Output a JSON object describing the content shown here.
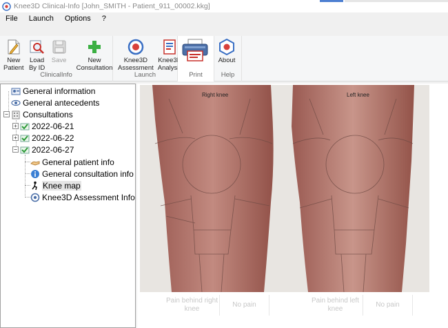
{
  "window": {
    "title": "Knee3D Clinical-Info  [John_SMITH - Patient_911_00002.kkg]"
  },
  "menu": {
    "items": [
      "File",
      "Launch",
      "Options",
      "?"
    ]
  },
  "ribbon": {
    "groups": [
      {
        "label": "ClinicalInfo",
        "buttons": [
          {
            "label": "New\nPatient"
          },
          {
            "label": "Load\nBy ID"
          },
          {
            "label": "Save"
          },
          {
            "label": "New\nConsultation"
          }
        ]
      },
      {
        "label": "Launch",
        "buttons": [
          {
            "label": "Knee3D\nAssessment"
          },
          {
            "label": "Knee3D\nAnalysis"
          }
        ]
      },
      {
        "label": "Print",
        "buttons": []
      },
      {
        "label": "Help",
        "buttons": [
          {
            "label": "About"
          }
        ]
      }
    ]
  },
  "tree": {
    "general_information": "General information",
    "general_antecedents": "General antecedents",
    "consultations": "Consultations",
    "dates": [
      "2022-06-21",
      "2022-06-22",
      "2022-06-27"
    ],
    "children": [
      "General patient info",
      "General consultation info",
      "Knee map",
      "Knee3D Assessment Info"
    ]
  },
  "knee_map": {
    "right_knee_label": "Right knee",
    "left_knee_label": "Left knee",
    "pain_right_label": "Pain behind right knee",
    "pain_right_value": "No pain",
    "pain_left_label": "Pain behind left knee",
    "pain_left_value": "No pain"
  },
  "colors": {
    "accent": "#4d7fd1",
    "skin": "#b8756c",
    "background": "#e8e5e1"
  }
}
